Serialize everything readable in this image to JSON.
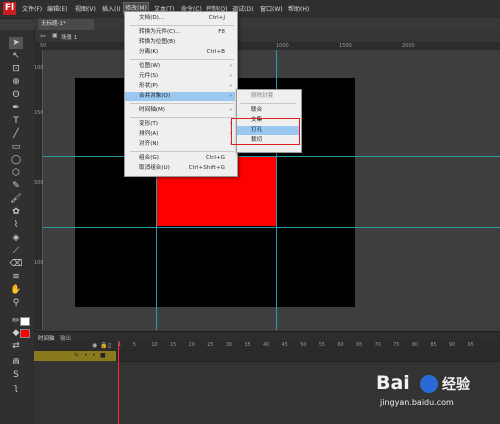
{
  "app": {
    "logo": "Fl"
  },
  "menubar": [
    "文件(F)",
    "编辑(E)",
    "视图(V)",
    "插入(I)",
    "修改(M)",
    "文本(T)",
    "命令(C)",
    "控制(O)",
    "调试(D)",
    "窗口(W)",
    "帮助(H)"
  ],
  "document": {
    "tab_title": "无标题-1*",
    "scene": "场景 1"
  },
  "ruler": {
    "top_labels": [
      "50",
      "1000",
      "1500",
      "2000"
    ],
    "left_labels": [
      "100",
      "150",
      "500",
      "1000"
    ]
  },
  "modify_menu": {
    "items": [
      {
        "label": "文档(D)...",
        "shortcut": "Ctrl+J",
        "submenu": false
      },
      {
        "label": "转换为元件(C)...",
        "shortcut": "F8",
        "submenu": false
      },
      {
        "label": "转换为位图(B)",
        "shortcut": "",
        "submenu": false
      },
      {
        "label": "分离(K)",
        "shortcut": "Ctrl+B",
        "submenu": false
      },
      {
        "label": "位图(W)",
        "shortcut": "",
        "submenu": true
      },
      {
        "label": "元件(S)",
        "shortcut": "",
        "submenu": true
      },
      {
        "label": "形状(P)",
        "shortcut": "",
        "submenu": true
      },
      {
        "label": "合并对象(O)",
        "shortcut": "",
        "submenu": true,
        "highlighted": true
      },
      {
        "label": "时间轴(M)",
        "shortcut": "",
        "submenu": true
      },
      {
        "label": "变形(T)",
        "shortcut": "",
        "submenu": true
      },
      {
        "label": "排列(A)",
        "shortcut": "",
        "submenu": true
      },
      {
        "label": "对齐(N)",
        "shortcut": "",
        "submenu": true
      },
      {
        "label": "组合(G)",
        "shortcut": "Ctrl+G",
        "submenu": false
      },
      {
        "label": "取消组合(U)",
        "shortcut": "Ctrl+Shift+G",
        "submenu": false
      }
    ]
  },
  "combine_menu": {
    "items": [
      {
        "label": "删除封套",
        "disabled": true
      },
      {
        "label": "联合",
        "disabled": false
      },
      {
        "label": "交集",
        "disabled": false
      },
      {
        "label": "打孔",
        "disabled": false,
        "highlighted": true
      },
      {
        "label": "裁切",
        "disabled": false
      }
    ]
  },
  "timeline": {
    "tabs": [
      "时间轴",
      "输出"
    ],
    "frame_numbers": [
      "1",
      "5",
      "10",
      "15",
      "20",
      "25",
      "30",
      "35",
      "40",
      "45",
      "50",
      "55",
      "60",
      "65",
      "70",
      "75",
      "80",
      "85",
      "90",
      "95"
    ]
  },
  "watermark": {
    "brand": "Bai",
    "brand_cn": "经验",
    "url": "jingyan.baidu.com"
  },
  "colors": {
    "stage": "#000000",
    "shape": "#ff0000",
    "guides": "#2c9aa8",
    "highlight": "#9ac8f0",
    "annotation": "#e02020"
  }
}
